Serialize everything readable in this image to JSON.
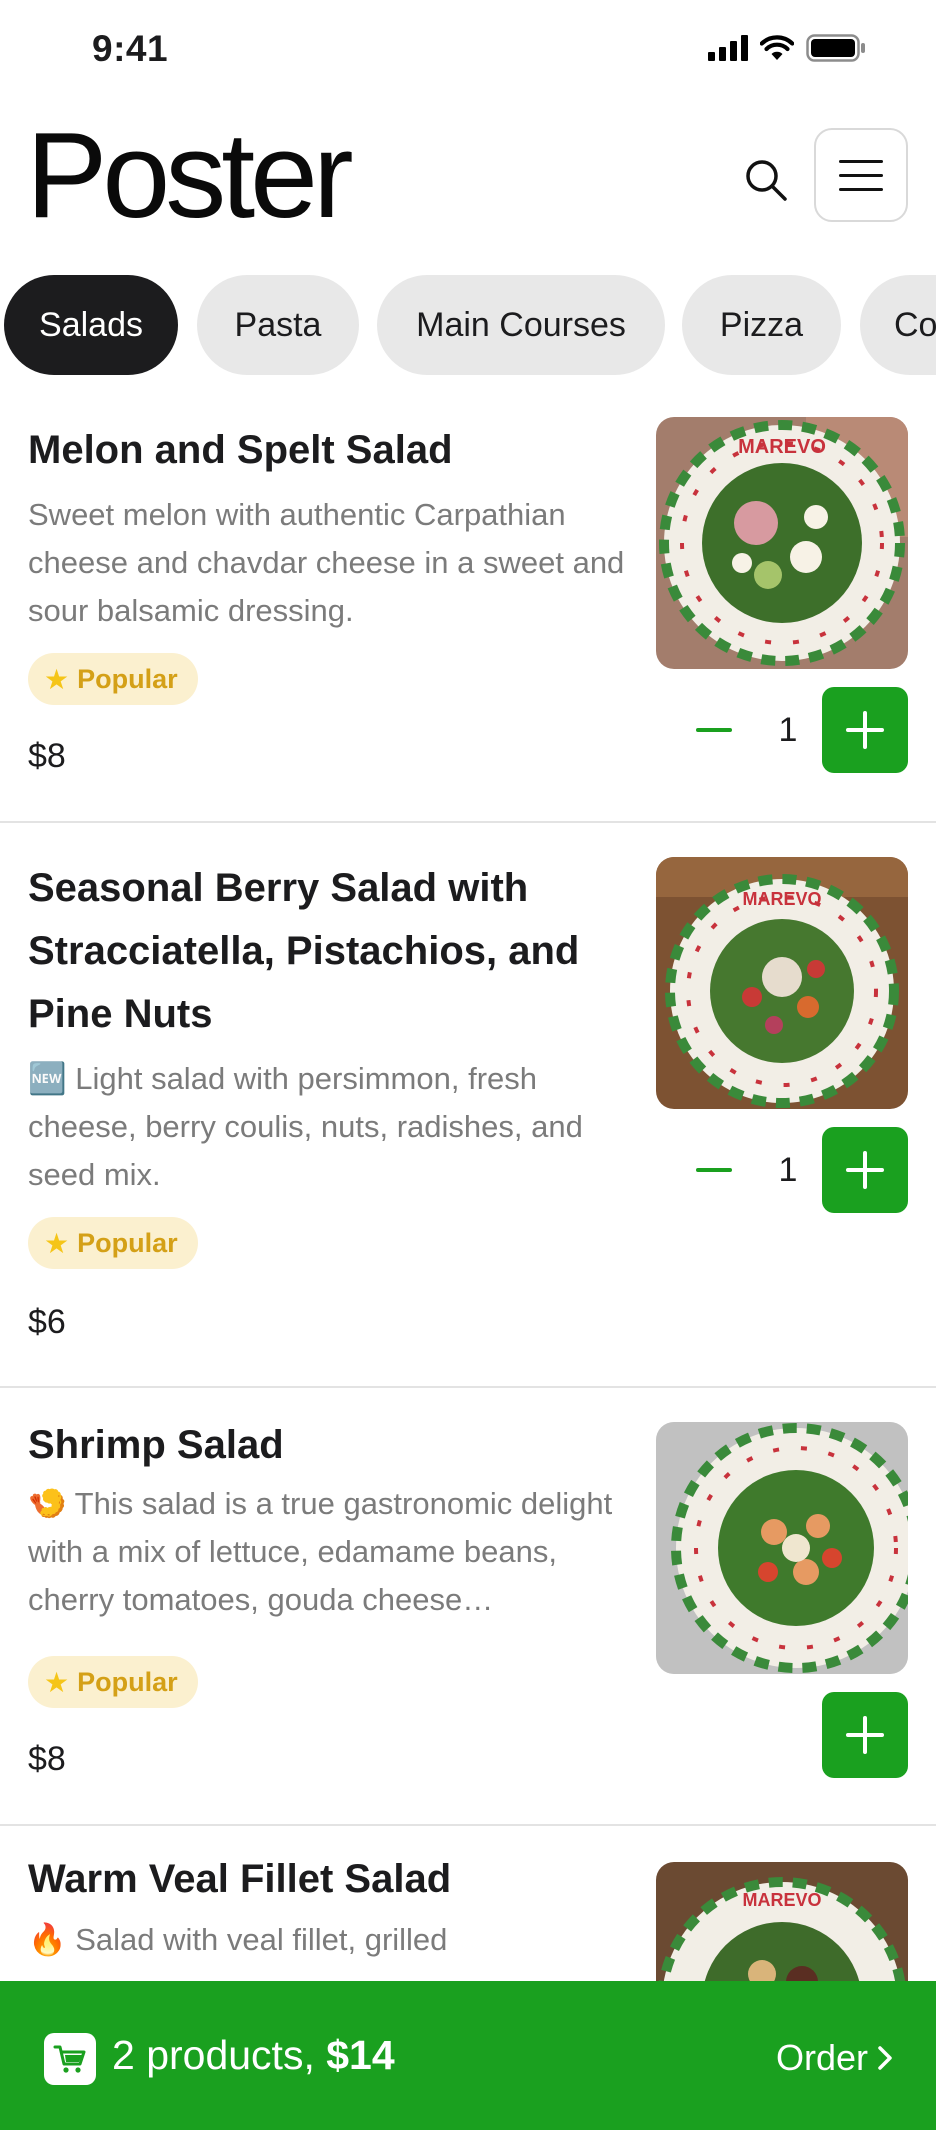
{
  "status_bar": {
    "time": "9:41"
  },
  "header": {
    "logo": "Poster"
  },
  "categories": [
    {
      "label": "Salads",
      "active": true
    },
    {
      "label": "Pasta",
      "active": false
    },
    {
      "label": "Main Courses",
      "active": false
    },
    {
      "label": "Pizza",
      "active": false
    },
    {
      "label": "Co",
      "active": false
    }
  ],
  "products": [
    {
      "title": "Melon and Spelt Salad",
      "description": "Sweet melon with authentic Carpathian cheese and chavdar cheese in a sweet and sour balsamic dressing.",
      "badge": "Popular",
      "price": "$8",
      "quantity": "1",
      "image_icon": "salad-plate-photo"
    },
    {
      "title": "Seasonal Berry Salad with Stracciatella, Pistachios, and Pine Nuts",
      "description_emoji": "🆕",
      "description": "Light salad with persimmon, fresh cheese, berry coulis, nuts, radishes, and seed mix.",
      "badge": "Popular",
      "price": "$6",
      "quantity": "1",
      "image_icon": "salad-plate-photo"
    },
    {
      "title": "Shrimp Salad",
      "description_emoji": "🍤",
      "description": "This salad is a true gastronomic delight with a mix of lettuce, edamame beans, cherry tomatoes, gouda cheese…",
      "badge": "Popular",
      "price": "$8",
      "image_icon": "salad-plate-photo"
    },
    {
      "title": "Warm Veal Fillet Salad",
      "description_emoji": "🔥",
      "description": "Salad with veal fillet, grilled",
      "image_icon": "salad-plate-photo"
    }
  ],
  "cart": {
    "summary_prefix": "2 products,",
    "total": "$14",
    "order_label": "Order"
  },
  "colors": {
    "accent_green": "#1aa01f",
    "badge_bg": "#fbf0cf",
    "badge_text": "#d4a017",
    "chip_active": "#1c1c1e",
    "chip_inactive": "#e8e8e8"
  }
}
